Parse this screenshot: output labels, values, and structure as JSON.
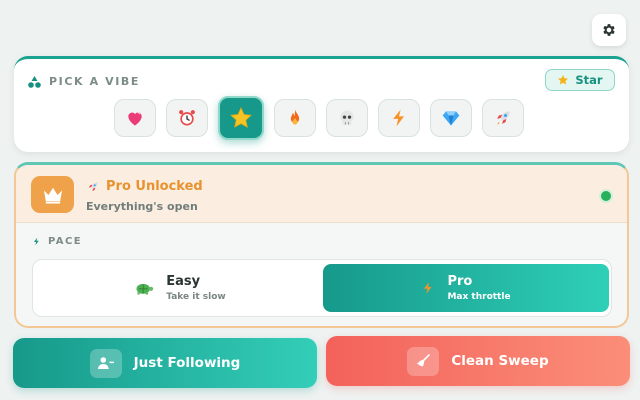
{
  "colors": {
    "accent": "#16998a",
    "pro_orange": "#f0a24a",
    "status_green": "#26b15a",
    "danger": "#f3625b",
    "background": "#eef2f1"
  },
  "settings": {
    "icon": "gear-icon"
  },
  "vibe": {
    "title": "PICK A VIBE",
    "badge_label": "Star",
    "emojis": [
      {
        "name": "heart",
        "icon": "heart-icon",
        "selected": false
      },
      {
        "name": "alarm-clock",
        "icon": "alarm-clock-icon",
        "selected": false
      },
      {
        "name": "star",
        "icon": "star-icon",
        "selected": true
      },
      {
        "name": "fire",
        "icon": "fire-icon",
        "selected": false
      },
      {
        "name": "skull",
        "icon": "skull-icon",
        "selected": false
      },
      {
        "name": "lightning",
        "icon": "lightning-icon",
        "selected": false
      },
      {
        "name": "gem",
        "icon": "gem-icon",
        "selected": false
      },
      {
        "name": "rocket",
        "icon": "rocket-icon",
        "selected": false
      }
    ]
  },
  "pro": {
    "title": "Pro Unlocked",
    "subtitle": "Everything's open",
    "pace_label": "PACE",
    "options": {
      "easy": {
        "name": "Easy",
        "sub": "Take it slow",
        "selected": false
      },
      "pro": {
        "name": "Pro",
        "sub": "Max throttle",
        "selected": true
      }
    }
  },
  "actions": {
    "follow_label": "Just Following",
    "sweep_label": "Clean Sweep"
  }
}
